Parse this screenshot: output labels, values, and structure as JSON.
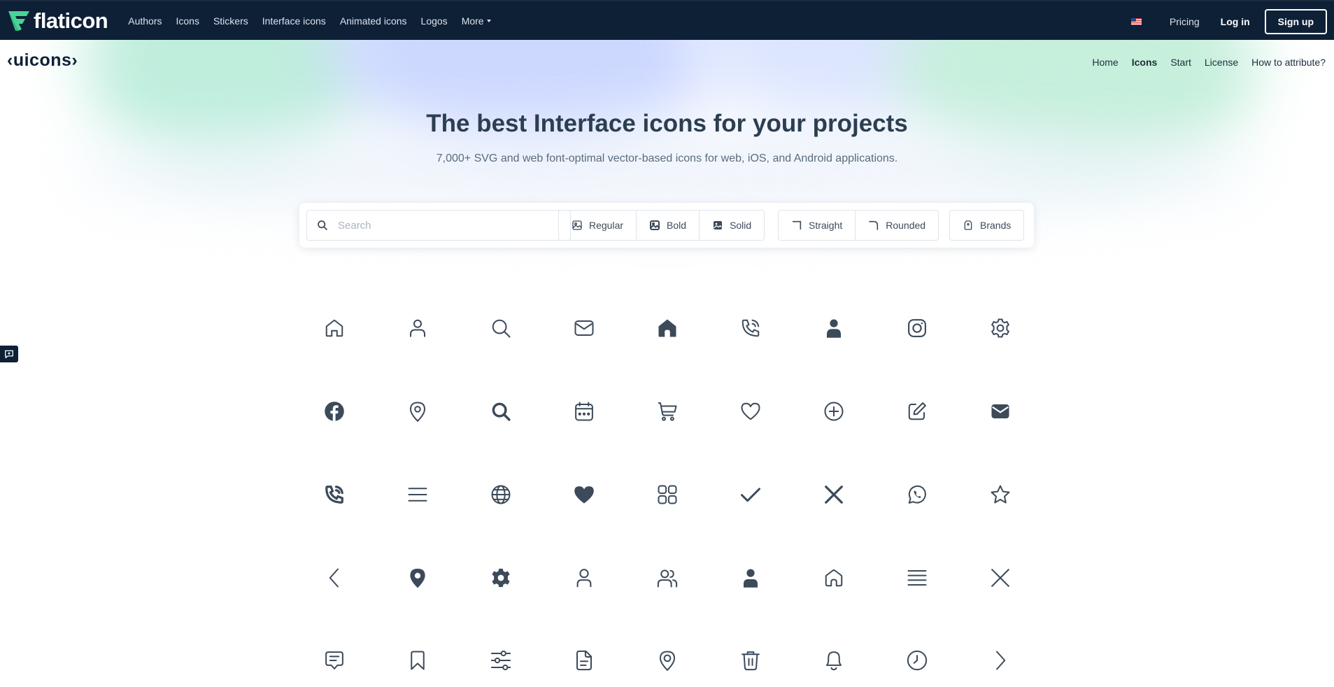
{
  "topbar": {
    "logo_text": "flaticon",
    "nav": [
      {
        "label": "Authors"
      },
      {
        "label": "Icons"
      },
      {
        "label": "Stickers"
      },
      {
        "label": "Interface icons"
      },
      {
        "label": "Animated icons"
      },
      {
        "label": "Logos"
      }
    ],
    "more_label": "More",
    "flag_icon": "us-flag-icon",
    "pricing_label": "Pricing",
    "login_label": "Log in",
    "signup_label": "Sign up"
  },
  "subheader": {
    "logo_text": "‹uicons›",
    "nav": [
      {
        "label": "Home",
        "active": false
      },
      {
        "label": "Icons",
        "active": true
      },
      {
        "label": "Start",
        "active": false
      },
      {
        "label": "License",
        "active": false
      },
      {
        "label": "How to attribute?",
        "active": false
      }
    ]
  },
  "hero": {
    "title": "The best Interface icons for your projects",
    "subtitle": "7,000+ SVG and web font-optimal vector-based icons for web, iOS, and Android applications."
  },
  "search": {
    "placeholder": "Search",
    "weight_filters": [
      {
        "label": "Regular",
        "icon": "image-regular-icon"
      },
      {
        "label": "Bold",
        "icon": "image-bold-icon"
      },
      {
        "label": "Solid",
        "icon": "image-solid-icon"
      }
    ],
    "corner_filters": [
      {
        "label": "Straight",
        "icon": "corner-straight-icon"
      },
      {
        "label": "Rounded",
        "icon": "corner-rounded-icon"
      }
    ],
    "brands_filter": {
      "label": "Brands",
      "icon": "brands-icon"
    }
  },
  "colors": {
    "topbar_bg": "#0e2036",
    "icon_color": "#3c4a5a",
    "accent_green": "#4ad395"
  },
  "icons": [
    "home-icon",
    "user-icon",
    "search-icon",
    "envelope-icon",
    "home-solid-icon",
    "phone-call-icon",
    "user-solid-icon",
    "instagram-icon",
    "settings-icon",
    "facebook-icon",
    "marker-icon",
    "search-bold-icon",
    "calendar-icon",
    "shopping-cart-icon",
    "heart-icon",
    "add-icon",
    "edit-icon",
    "envelope-solid-icon",
    "phone-call-bold-icon",
    "menu-burger-icon",
    "globe-icon",
    "heart-solid-icon",
    "apps-icon",
    "check-icon",
    "cross-bold-icon",
    "whatsapp-icon",
    "star-icon",
    "angle-left-icon",
    "marker-solid-icon",
    "settings-solid-icon",
    "user-regular-icon",
    "users-icon",
    "user-filled-icon",
    "home-rounded-icon",
    "align-justify-icon",
    "cross-icon",
    "comment-alt-icon",
    "bookmark-icon",
    "settings-sliders-icon",
    "document-icon",
    "location-alt-icon",
    "trash-icon",
    "bell-icon",
    "clock-icon",
    "angle-right-icon"
  ]
}
